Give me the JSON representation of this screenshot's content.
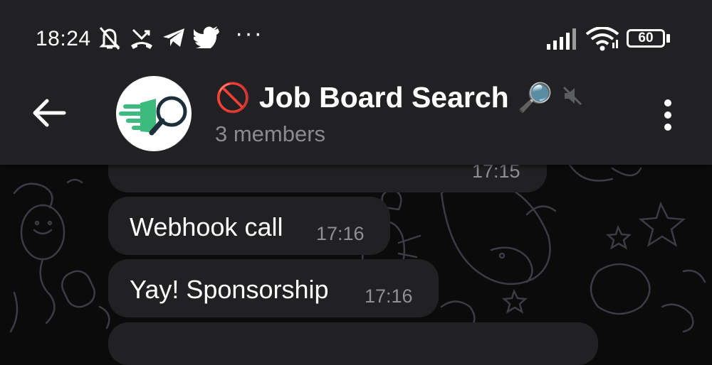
{
  "status_bar": {
    "time": "18:24",
    "more_indicator": "···",
    "battery": "60",
    "icons": [
      "bell-off-icon",
      "missed-call-icon",
      "telegram-icon",
      "twitter-icon",
      "signal-icon",
      "wifi-icon",
      "battery-icon"
    ]
  },
  "chat_header": {
    "title_emoji_left": "🚫",
    "title": "Job Board Search",
    "title_emoji_right": "🔎",
    "members": "3 members",
    "muted": true,
    "avatar_icon": "fast-search-magnifier-icon",
    "colors": {
      "header_bg": "#212123",
      "subtitle": "#8a8b8e",
      "avatar_green": "#3dbb7e"
    }
  },
  "messages": [
    {
      "text": "",
      "time": "17:15"
    },
    {
      "text": "Webhook call",
      "time": "17:16"
    },
    {
      "text": "Yay! Sponsorship",
      "time": "17:16"
    }
  ]
}
